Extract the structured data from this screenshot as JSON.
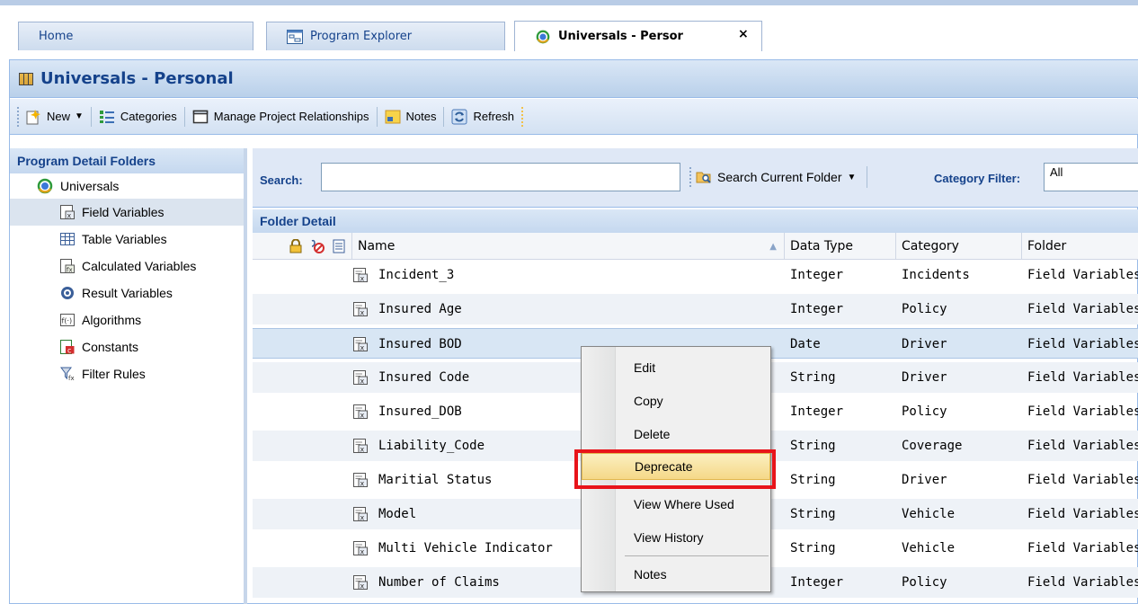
{
  "tabs": [
    {
      "label": "Home"
    },
    {
      "label": "Program Explorer",
      "icon": "program-explorer-icon"
    },
    {
      "label": "Universals - Persor",
      "icon": "universals-icon",
      "close": "×"
    }
  ],
  "panel": {
    "title": "Universals - Personal"
  },
  "toolbar": {
    "new": "New",
    "categories": "Categories",
    "manage": "Manage Project Relationships",
    "notes": "Notes",
    "refresh": "Refresh"
  },
  "nav": {
    "header": "Program Detail Folders",
    "root": "Universals",
    "items": [
      {
        "label": "Field Variables"
      },
      {
        "label": "Table Variables"
      },
      {
        "label": "Calculated Variables"
      },
      {
        "label": "Result Variables"
      },
      {
        "label": "Algorithms"
      },
      {
        "label": "Constants"
      },
      {
        "label": "Filter Rules"
      }
    ]
  },
  "search": {
    "label": "Search:",
    "value": "",
    "scope_button": "Search Current Folder",
    "category_label": "Category Filter:",
    "category_value": "All"
  },
  "folder_detail": {
    "header": "Folder Detail",
    "columns": {
      "name": "Name",
      "type": "Data Type",
      "category": "Category",
      "folder": "Folder"
    },
    "rows": [
      {
        "name": "Incident_3",
        "type": "Integer",
        "category": "Incidents",
        "folder": "Field Variables"
      },
      {
        "name": "Insured Age",
        "type": "Integer",
        "category": "Policy",
        "folder": "Field Variables"
      },
      {
        "name": "Insured BOD",
        "type": "Date",
        "category": "Driver",
        "folder": "Field Variables"
      },
      {
        "name": "Insured Code",
        "type": "String",
        "category": "Driver",
        "folder": "Field Variables"
      },
      {
        "name": "Insured_DOB",
        "type": "Integer",
        "category": "Policy",
        "folder": "Field Variables"
      },
      {
        "name": "Liability_Code",
        "type": "String",
        "category": "Coverage",
        "folder": "Field Variables"
      },
      {
        "name": "Maritial Status",
        "type": "String",
        "category": "Driver",
        "folder": "Field Variables"
      },
      {
        "name": "Model",
        "type": "String",
        "category": "Vehicle",
        "folder": "Field Variables"
      },
      {
        "name": "Multi Vehicle Indicator",
        "type": "String",
        "category": "Vehicle",
        "folder": "Field Variables"
      },
      {
        "name": "Number of Claims",
        "type": "Integer",
        "category": "Policy",
        "folder": "Field Variables"
      }
    ]
  },
  "context_menu": {
    "items": [
      {
        "label": "Edit"
      },
      {
        "label": "Copy"
      },
      {
        "label": "Delete"
      },
      {
        "label": "Deprecate",
        "highlighted": true
      },
      {
        "label": "View Where Used"
      },
      {
        "label": "View History"
      },
      {
        "label": "Notes"
      }
    ]
  },
  "colors": {
    "accent": "#15428b",
    "highlight_border": "#e8141a",
    "selected_row": "#d8e6f4"
  }
}
